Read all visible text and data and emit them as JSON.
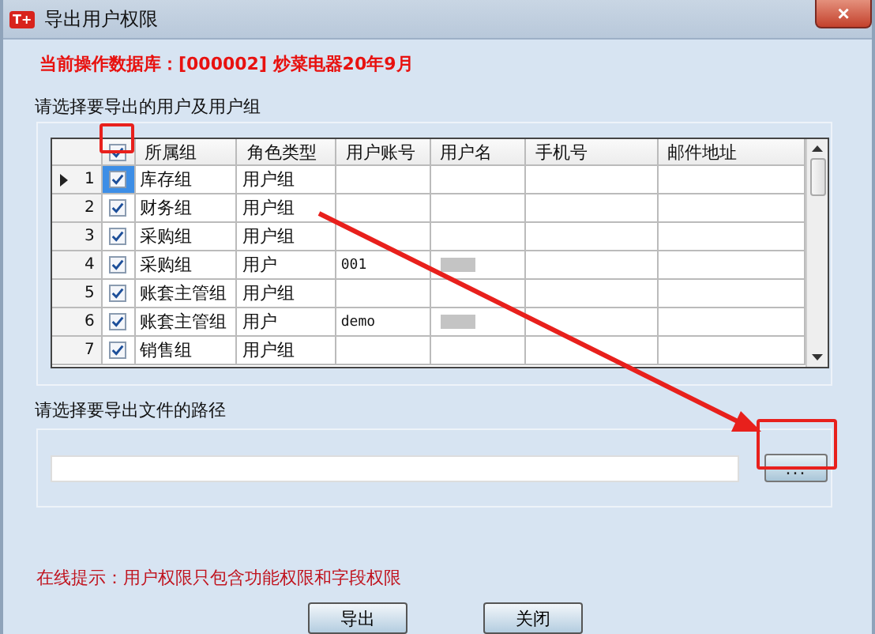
{
  "window": {
    "logo": "T+",
    "title": "导出用户权限",
    "close": "×"
  },
  "database_line": "当前操作数据库：[000002] 炒菜电器20年9月",
  "users_group": {
    "label": "请选择要导出的用户及用户组",
    "all_checked": true,
    "columns": [
      "所属组",
      "角色类型",
      "用户账号",
      "用户名",
      "手机号",
      "邮件地址"
    ],
    "rows": [
      {
        "index": "1",
        "selected": true,
        "checked": true,
        "cells": [
          "库存组",
          "用户组",
          "",
          "",
          "",
          ""
        ],
        "blurred_name": false
      },
      {
        "index": "2",
        "selected": false,
        "checked": true,
        "cells": [
          "财务组",
          "用户组",
          "",
          "",
          "",
          ""
        ],
        "blurred_name": false
      },
      {
        "index": "3",
        "selected": false,
        "checked": true,
        "cells": [
          "采购组",
          "用户组",
          "",
          "",
          "",
          ""
        ],
        "blurred_name": false
      },
      {
        "index": "4",
        "selected": false,
        "checked": true,
        "cells": [
          "采购组",
          "用户",
          "001",
          "",
          "",
          ""
        ],
        "blurred_name": true
      },
      {
        "index": "5",
        "selected": false,
        "checked": true,
        "cells": [
          "账套主管组",
          "用户组",
          "",
          "",
          "",
          ""
        ],
        "blurred_name": false
      },
      {
        "index": "6",
        "selected": false,
        "checked": true,
        "cells": [
          "账套主管组",
          "用户",
          "demo",
          "",
          "",
          ""
        ],
        "blurred_name": true
      },
      {
        "index": "7",
        "selected": false,
        "checked": true,
        "cells": [
          "销售组",
          "用户组",
          "",
          "",
          "",
          ""
        ],
        "blurred_name": false
      }
    ]
  },
  "path_group": {
    "label": "请选择要导出文件的路径",
    "browse": "..."
  },
  "hint": "在线提示：用户权限只包含功能权限和字段权限",
  "buttons": [
    "导出",
    "关闭"
  ]
}
